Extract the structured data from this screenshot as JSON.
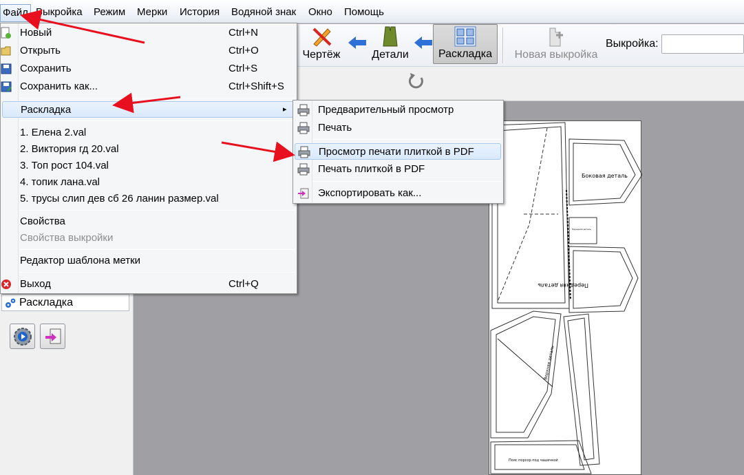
{
  "menubar": {
    "items": [
      "Файл",
      "Выкройка",
      "Режим",
      "Мерки",
      "История",
      "Водяной знак",
      "Окно",
      "Помощь"
    ]
  },
  "toolbar": {
    "draw_label": "Чертёж",
    "details_label": "Детали",
    "layout_label": "Раскладка",
    "new_pattern_label": "Новая выкройка",
    "pattern_label": "Выкройка:",
    "pattern_value": ""
  },
  "file_menu": {
    "items": [
      {
        "label": "Новый",
        "shortcut": "Ctrl+N",
        "icon": "new-icon"
      },
      {
        "label": "Открыть",
        "shortcut": "Ctrl+O",
        "icon": "open-icon"
      },
      {
        "label": "Сохранить",
        "shortcut": "Ctrl+S",
        "icon": "save-icon"
      },
      {
        "label": "Сохранить как...",
        "shortcut": "Ctrl+Shift+S",
        "icon": "save-as-icon"
      },
      {
        "label": "Раскладка",
        "submenu_arrow": "▸"
      },
      {
        "label": "1. Елена 2.val"
      },
      {
        "label": "2. Виктория гд 20.val"
      },
      {
        "label": "3. Топ рост 104.val"
      },
      {
        "label": "4. топик лана.val"
      },
      {
        "label": "5. трусы слип дев сб 26 ланин размер.val"
      },
      {
        "label": "Свойства"
      },
      {
        "label": "Свойства выкройки",
        "disabled": true
      },
      {
        "label": "Редактор шаблона метки"
      },
      {
        "label": "Выход",
        "shortcut": "Ctrl+Q",
        "icon": "exit-icon"
      }
    ]
  },
  "layout_submenu": {
    "items": [
      {
        "label": "Предварительный просмотр",
        "icon": "printer-icon"
      },
      {
        "label": "Печать",
        "icon": "printer-icon"
      },
      {
        "label": "Просмотр печати плиткой в PDF",
        "icon": "printer-icon"
      },
      {
        "label": "Печать плиткой в PDF",
        "icon": "printer-icon"
      },
      {
        "label": "Экспортировать как...",
        "icon": "export-icon"
      }
    ]
  },
  "left_panel": {
    "group_label": "Раскладка"
  },
  "sheet_labels": {
    "side_piece": "Боковая деталь",
    "front_piece": "Передняя деталь",
    "small_label": "Передняя деталь",
    "waist_label": "Пояс пододвинут",
    "upper_piece": "Верхняя деталь",
    "bottom_band": "Пояс порсор под чашечкой"
  },
  "colors": {
    "annotation_arrow": "#e8101e",
    "accent_blue": "#2e6fd8",
    "menu_highlight": "#d9e9fb"
  }
}
